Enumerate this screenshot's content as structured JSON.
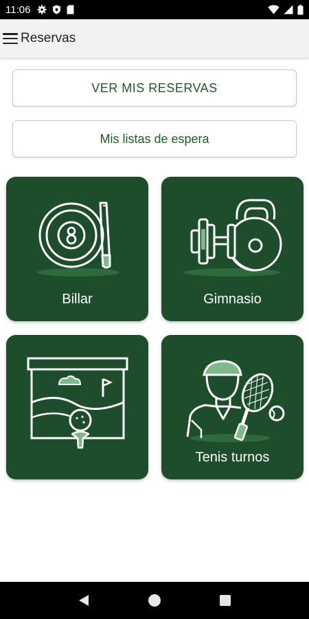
{
  "status_bar": {
    "time": "11:06",
    "icons": [
      "gear-icon",
      "shield-icon",
      "sim-icon"
    ],
    "right_icons": [
      "wifi-icon",
      "signal-icon",
      "battery-icon"
    ]
  },
  "app_bar": {
    "title": "Reservas",
    "menu_icon": "hamburger-menu-icon"
  },
  "buttons": {
    "my_reservations": "VER MIS RESERVAS",
    "waiting_lists": "Mis listas de espera"
  },
  "tiles": [
    {
      "label": "Billar",
      "icon": "billiard-icon"
    },
    {
      "label": "Gimnasio",
      "icon": "gym-icon"
    },
    {
      "label": "",
      "icon": "golf-simulator-icon"
    },
    {
      "label": "Tenis turnos",
      "icon": "tennis-player-icon"
    }
  ],
  "colors": {
    "tile_bg": "#1d4d2b",
    "accent_text": "#1e5a2d",
    "illustration_light": "#7fb98a",
    "illustration_shadow": "#2f6a3e"
  },
  "nav_bar": {
    "buttons": [
      "back-icon",
      "home-icon",
      "recents-icon"
    ]
  }
}
